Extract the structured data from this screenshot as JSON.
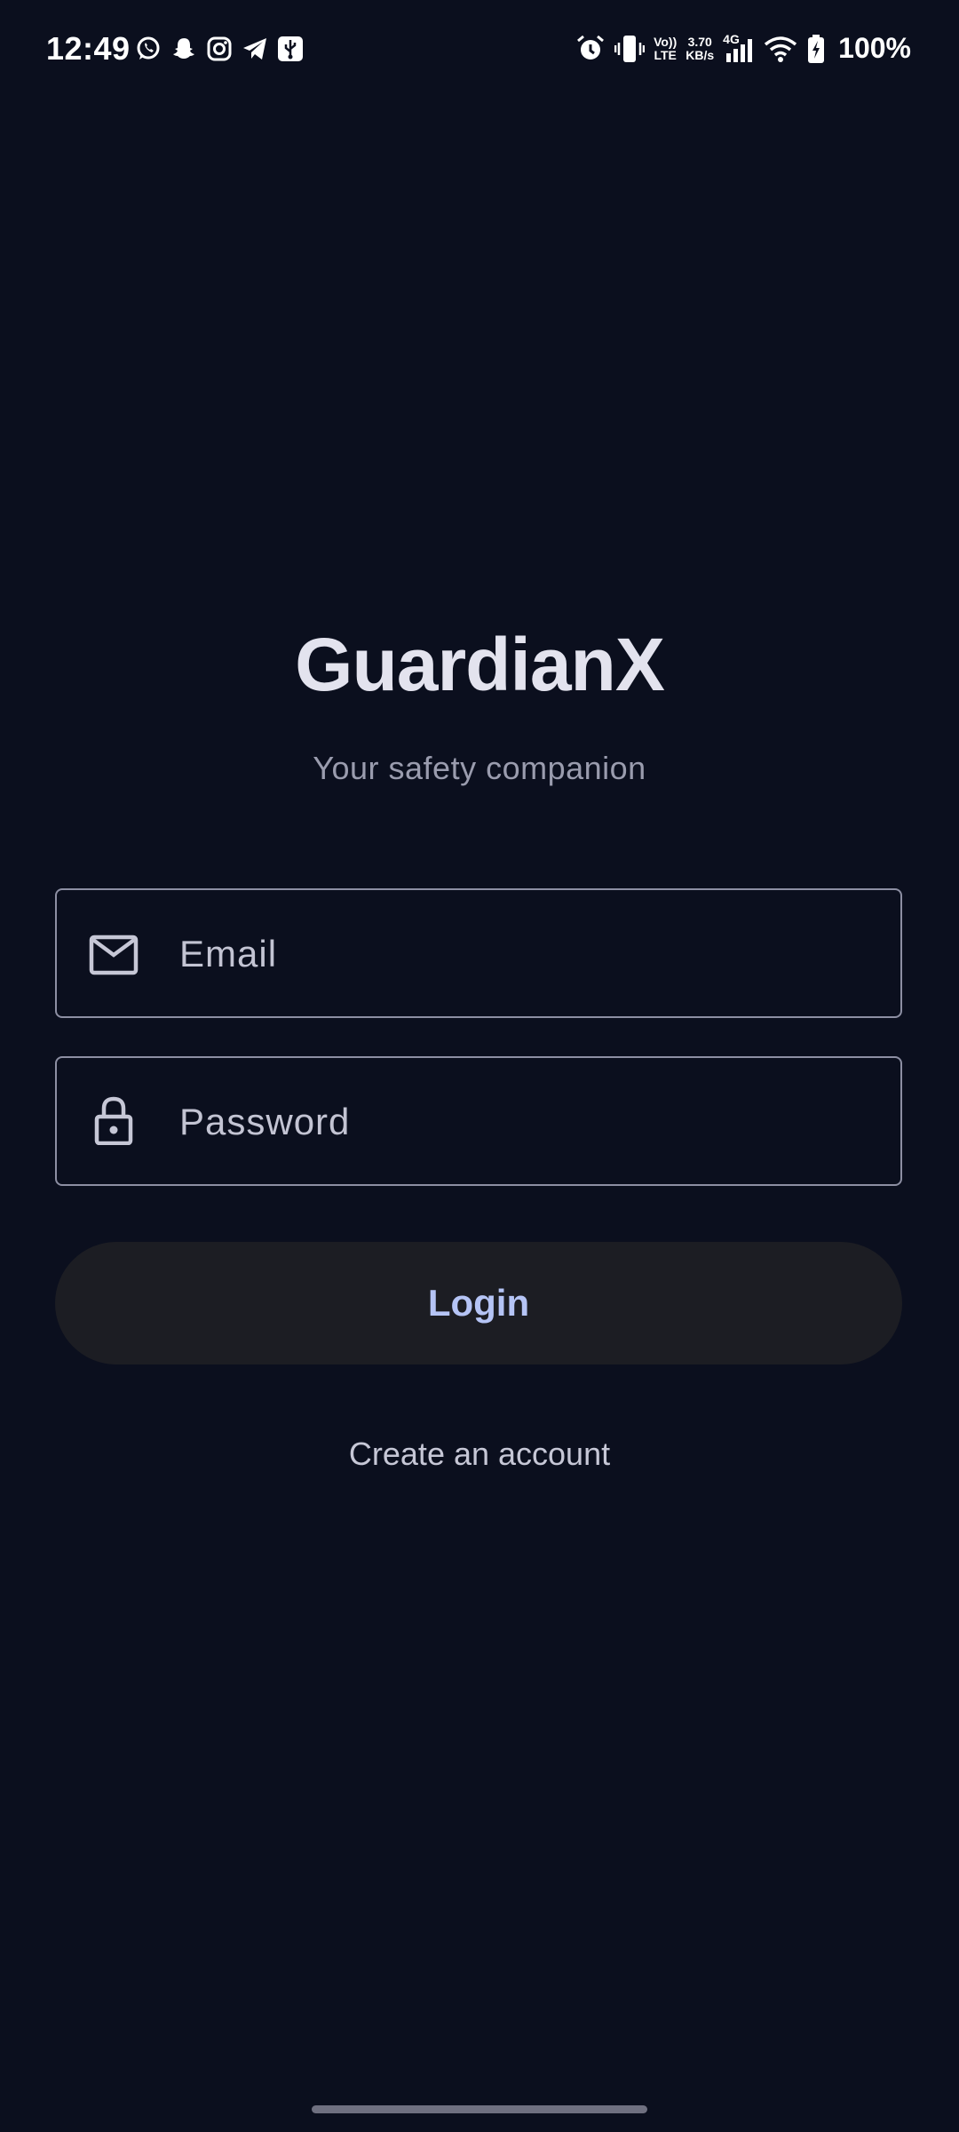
{
  "status_bar": {
    "time": "12:49",
    "volte_top": "Vo))",
    "volte_bottom": "LTE",
    "speed_value": "3.70",
    "speed_unit": "KB/s",
    "network_type": "4G",
    "battery_percent": "100%",
    "left_icons": [
      "whatsapp-icon",
      "snapchat-icon",
      "instagram-icon",
      "telegram-icon",
      "usb-icon"
    ],
    "right_icons": [
      "alarm-icon",
      "vibrate-icon",
      "signal-icon",
      "wifi-icon",
      "battery-charging-icon"
    ]
  },
  "app": {
    "title": "GuardianX",
    "subtitle": "Your safety companion"
  },
  "form": {
    "email": {
      "placeholder": "Email",
      "value": "",
      "icon": "mail-icon"
    },
    "password": {
      "placeholder": "Password",
      "value": "",
      "icon": "lock-icon"
    },
    "login_label": "Login",
    "create_account_label": "Create an account"
  },
  "colors": {
    "background": "#0b0f1e",
    "title": "#e3e3ee",
    "subtitle": "#9a9cae",
    "field_border": "#8d8fa3",
    "button_bg": "#1c1d23",
    "button_text": "#b5c4f5"
  }
}
